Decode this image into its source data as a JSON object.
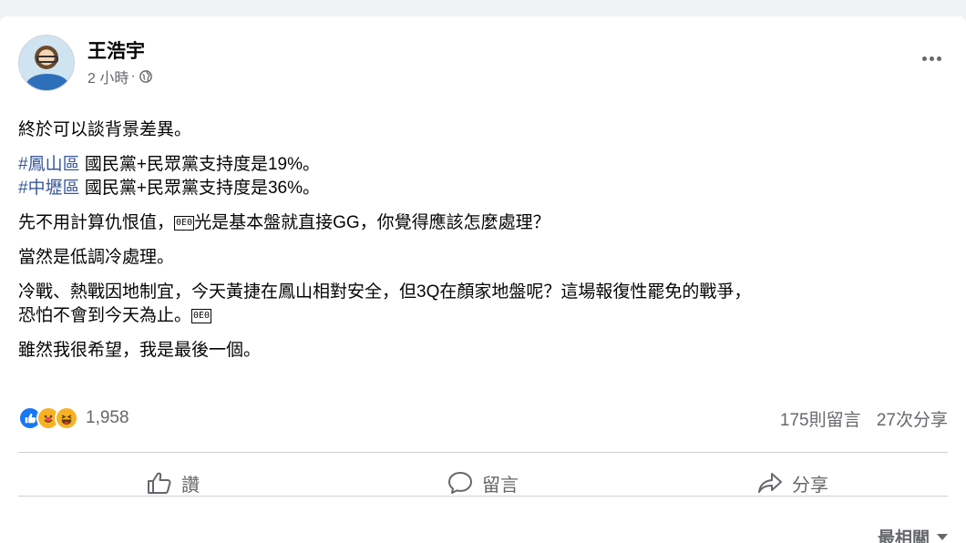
{
  "post": {
    "author": "王浩宇",
    "time": "2 小時",
    "dot": "·",
    "privacy_icon": "globe-icon",
    "more_icon": "more-options-icon"
  },
  "content": {
    "p1": "終於可以談背景差異。",
    "line2_tag": "#鳳山區",
    "line2_text": " 國民黨+民眾黨支持度是19%。",
    "line3_tag": "#中壢區",
    "line3_text": " 國民黨+民眾黨支持度是36%。",
    "p3_a": "先不用計算仇恨值，",
    "emoji": "0E0",
    "p3_b": "光是基本盤就直接GG，你覺得應該怎麼處理？",
    "p4": "當然是低調冷處理。",
    "p5_line1": "冷戰、熱戰因地制宜，今天黃捷在鳳山相對安全，但3Q在顏家地盤呢？這場報復性罷免的戰爭，",
    "p5_line2": "恐怕不會到今天為止。",
    "p6": "雖然我很希望，我是最後一個。"
  },
  "engagement": {
    "reaction_icons": [
      "like-reaction-icon",
      "care-reaction-icon",
      "haha-reaction-icon"
    ],
    "reaction_count": "1,958",
    "comments": "175則留言",
    "shares": "27次分享"
  },
  "actions": {
    "like": "讚",
    "comment": "留言",
    "share": "分享"
  },
  "sort": {
    "label": "最相關"
  },
  "colors": {
    "hashtag": "#385898",
    "secondary_text": "#65676b",
    "like_blue": "#1877f2",
    "reaction_yellow": "#f7b125"
  }
}
